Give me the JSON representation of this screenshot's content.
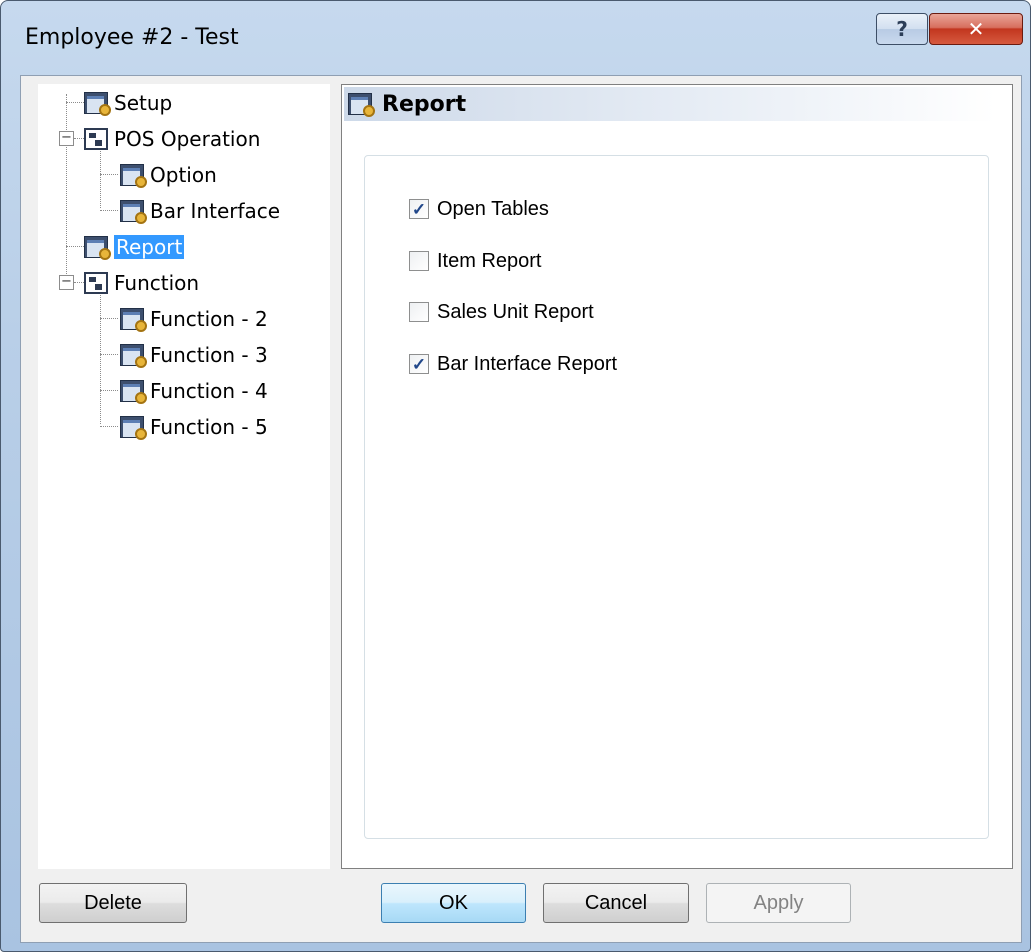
{
  "window": {
    "title": "Employee #2 - Test",
    "help_glyph": "?",
    "close_glyph": "✕"
  },
  "tree": {
    "items": [
      {
        "label": "Setup",
        "icon": "gear-window-icon"
      },
      {
        "label": "POS Operation",
        "icon": "tree-node-icon",
        "expanded": true
      },
      {
        "label": "Option",
        "icon": "gear-window-icon"
      },
      {
        "label": "Bar Interface",
        "icon": "gear-window-icon"
      },
      {
        "label": "Report",
        "icon": "gear-window-icon",
        "selected": true
      },
      {
        "label": "Function",
        "icon": "tree-node-icon",
        "expanded": true
      },
      {
        "label": "Function - 2",
        "icon": "gear-window-icon"
      },
      {
        "label": "Function - 3",
        "icon": "gear-window-icon"
      },
      {
        "label": "Function - 4",
        "icon": "gear-window-icon"
      },
      {
        "label": "Function - 5",
        "icon": "gear-window-icon"
      }
    ],
    "expander_glyph": "−"
  },
  "panel": {
    "title": "Report",
    "checkboxes": [
      {
        "label": "Open Tables",
        "checked": true
      },
      {
        "label": "Item Report",
        "checked": false
      },
      {
        "label": "Sales Unit Report",
        "checked": false
      },
      {
        "label": "Bar Interface Report",
        "checked": true
      }
    ],
    "check_glyph": "✓"
  },
  "buttons": {
    "delete": "Delete",
    "ok": "OK",
    "cancel": "Cancel",
    "apply": "Apply"
  },
  "colors": {
    "selection": "#3399ff",
    "close_button": "#c2361f",
    "default_button_border": "#3c7fb1"
  }
}
